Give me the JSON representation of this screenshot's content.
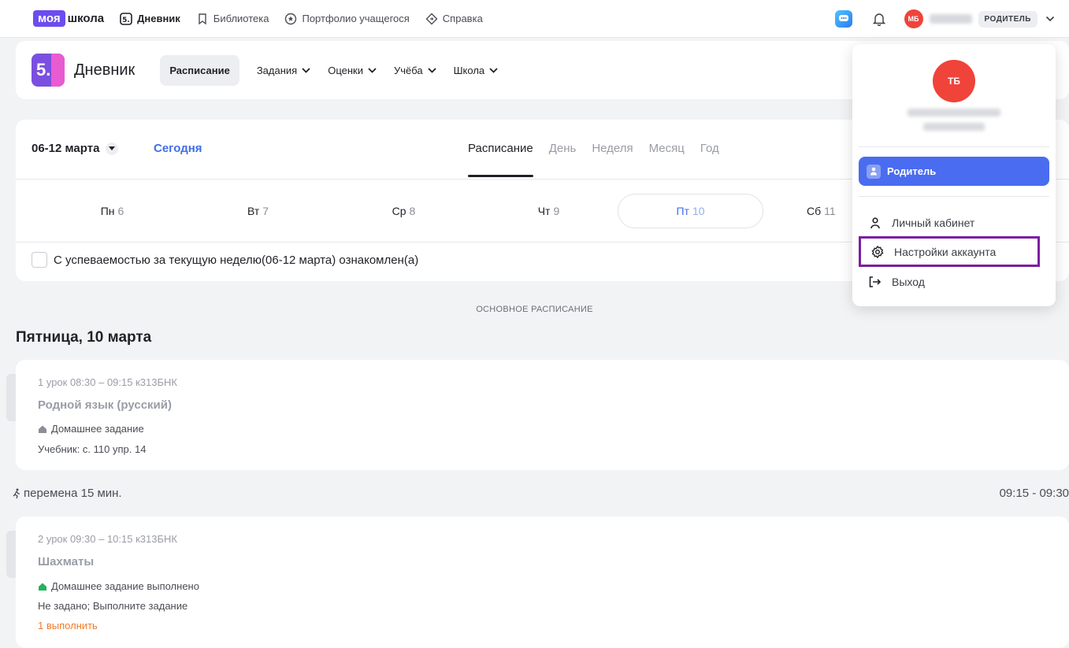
{
  "topbar": {
    "logo_moya": "моя",
    "logo_shkola": "школа",
    "nav": [
      {
        "label": "Дневник",
        "icon": "diary-5-icon"
      },
      {
        "label": "Библиотека",
        "icon": "bookmark-icon"
      },
      {
        "label": "Портфолио учащегося",
        "icon": "star-circle-icon"
      },
      {
        "label": "Справка",
        "icon": "diamond-help-icon"
      }
    ],
    "avatar_initials": "МБ",
    "role_badge": "РОДИТЕЛЬ"
  },
  "header": {
    "logo_digit": "5.",
    "title": "Дневник",
    "tabs": [
      {
        "label": "Расписание"
      },
      {
        "label": "Задания"
      },
      {
        "label": "Оценки"
      },
      {
        "label": "Учёба"
      },
      {
        "label": "Школа"
      }
    ]
  },
  "schedule": {
    "week_range": "06-12 марта",
    "today_label": "Сегодня",
    "view_tabs": [
      "Расписание",
      "День",
      "Неделя",
      "Месяц",
      "Год"
    ],
    "days": [
      {
        "name": "Пн",
        "num": "6"
      },
      {
        "name": "Вт",
        "num": "7"
      },
      {
        "name": "Ср",
        "num": "8"
      },
      {
        "name": "Чт",
        "num": "9"
      },
      {
        "name": "Пт",
        "num": "10"
      },
      {
        "name": "Сб",
        "num": "11"
      }
    ],
    "ack_text": "С успеваемостью за текущую неделю(06-12 марта) ознакомлен(а)"
  },
  "main": {
    "section_label": "ОСНОВНОЕ РАСПИСАНИЕ",
    "day_title": "Пятница, 10 марта",
    "lessons": [
      {
        "meta": "1 урок  08:30 – 09:15  к313БНК",
        "subject": "Родной язык (русский)",
        "hw_label": "Домашнее задание",
        "hw_text": "Учебник: с. 110 упр. 14"
      },
      {
        "meta": "2 урок  09:30 – 10:15  к313БНК",
        "subject": "Шахматы",
        "hw_label": "Домашнее задание выполнено",
        "hw_text": "Не задано; Выполните задание",
        "action": "1 выполнить"
      }
    ],
    "break_label": "перемена 15 мин.",
    "break_time": "09:15 - 09:30"
  },
  "dropdown": {
    "avatar_initials": "ТБ",
    "role_item": "Родитель",
    "items": [
      {
        "label": "Личный кабинет",
        "icon": "person-icon"
      },
      {
        "label": "Настройки аккаунта",
        "icon": "gear-icon"
      },
      {
        "label": "Выход",
        "icon": "logout-icon"
      }
    ]
  },
  "colors": {
    "brand": "#6d4cf0",
    "accent_blue": "#4a6cf0",
    "link_blue": "#3f6fe8",
    "avatar_red": "#f0433a",
    "highlight_purple": "#7b1fa2",
    "action_orange": "#ef7b2b"
  }
}
